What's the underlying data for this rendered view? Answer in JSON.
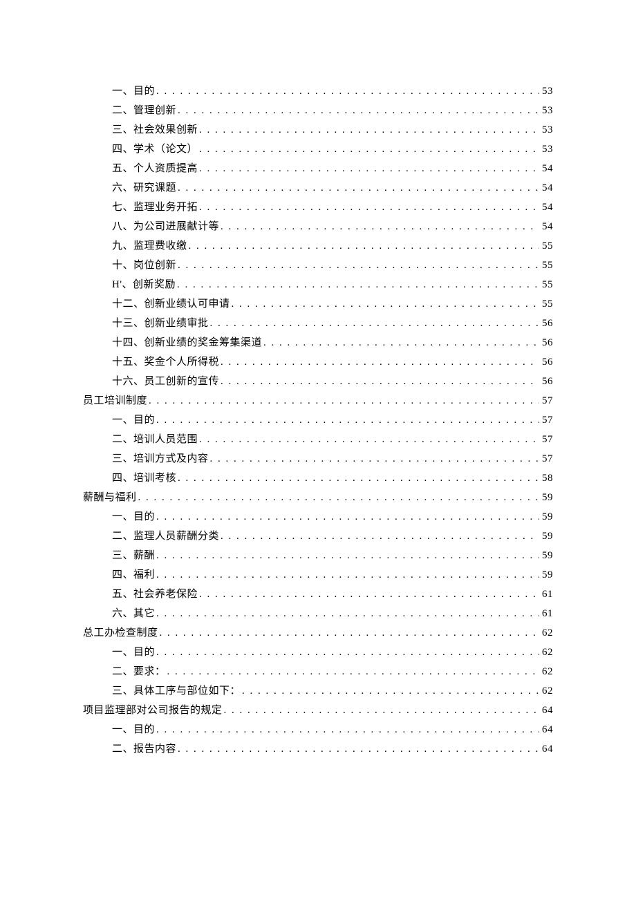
{
  "toc": [
    {
      "level": 2,
      "title": "一、目的",
      "page": "53"
    },
    {
      "level": 2,
      "title": "二、管理创新",
      "page": "53"
    },
    {
      "level": 2,
      "title": "三、社会效果创新",
      "page": "53"
    },
    {
      "level": 2,
      "title": "四、学术（论文）",
      "page": "53"
    },
    {
      "level": 2,
      "title": "五、个人资质提高",
      "page": "54"
    },
    {
      "level": 2,
      "title": "六、研究课题",
      "page": "54"
    },
    {
      "level": 2,
      "title": "七、监理业务开拓",
      "page": "54"
    },
    {
      "level": 2,
      "title": "八、为公司进展献计等",
      "page": "54"
    },
    {
      "level": 2,
      "title": "九、监理费收缴",
      "page": "55"
    },
    {
      "level": 2,
      "title": "十、岗位创新",
      "page": "55"
    },
    {
      "level": 2,
      "title": "H'、创新奖励",
      "page": "55"
    },
    {
      "level": 2,
      "title": "十二、创新业绩认可申请",
      "page": "55"
    },
    {
      "level": 2,
      "title": "十三、创新业绩审批",
      "page": "56"
    },
    {
      "level": 2,
      "title": "十四、创新业绩的奖金筹集渠道",
      "page": "56"
    },
    {
      "level": 2,
      "title": "十五、奖金个人所得税",
      "page": "56"
    },
    {
      "level": 2,
      "title": "十六、员工创新的宣传",
      "page": "56"
    },
    {
      "level": 1,
      "title": "员工培训制度",
      "page": "57"
    },
    {
      "level": 2,
      "title": "一、目的",
      "page": "57"
    },
    {
      "level": 2,
      "title": "二、培训人员范围",
      "page": "57"
    },
    {
      "level": 2,
      "title": "三、培训方式及内容",
      "page": "57"
    },
    {
      "level": 2,
      "title": "四、培训考核",
      "page": "58"
    },
    {
      "level": 1,
      "title": "薪酬与福利",
      "page": "59"
    },
    {
      "level": 2,
      "title": "一、目的",
      "page": "59"
    },
    {
      "level": 2,
      "title": "二、监理人员薪酬分类",
      "page": "59"
    },
    {
      "level": 2,
      "title": "三、薪酬",
      "page": "59"
    },
    {
      "level": 2,
      "title": "四、福利",
      "page": "59"
    },
    {
      "level": 2,
      "title": "五、社会养老保险",
      "page": "61"
    },
    {
      "level": 2,
      "title": "六、其它",
      "page": "61"
    },
    {
      "level": 1,
      "title": "总工办检查制度",
      "page": "62"
    },
    {
      "level": 2,
      "title": "一、目的",
      "page": "62"
    },
    {
      "level": 2,
      "title": "二、要求：",
      "page": "62"
    },
    {
      "level": 2,
      "title": "三、具体工序与部位如下：",
      "page": "62"
    },
    {
      "level": 1,
      "title": "项目监理部对公司报告的规定",
      "page": "64"
    },
    {
      "level": 2,
      "title": "一、目的",
      "page": "64"
    },
    {
      "level": 2,
      "title": "二、报告内容",
      "page": "64"
    }
  ]
}
